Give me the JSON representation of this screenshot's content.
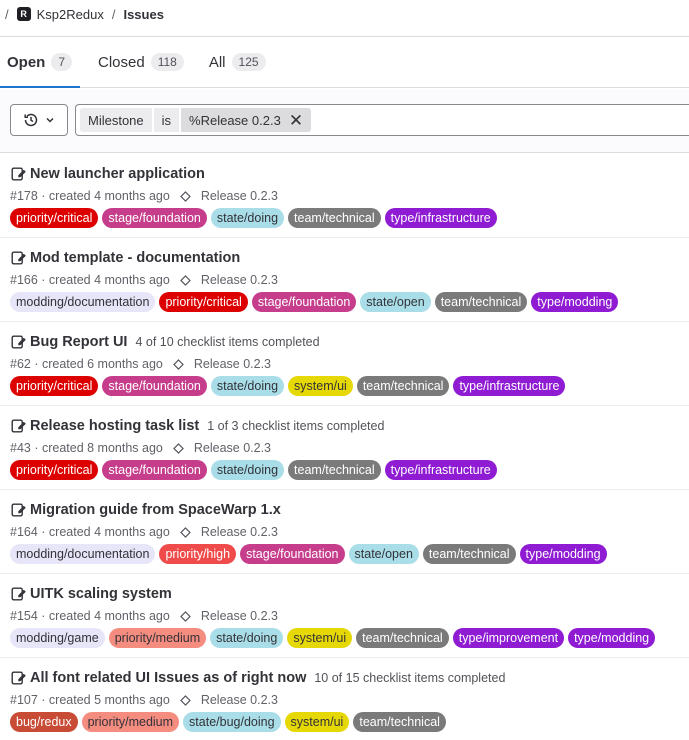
{
  "breadcrumb": {
    "separator": "/",
    "project_initial": "R",
    "project": "Ksp2Redux",
    "current": "Issues"
  },
  "tabs": [
    {
      "label": "Open",
      "count": "7",
      "active": true
    },
    {
      "label": "Closed",
      "count": "118",
      "active": false
    },
    {
      "label": "All",
      "count": "125",
      "active": false
    }
  ],
  "filter": {
    "history_icon": "history-icon",
    "token_name": "Milestone",
    "token_operator": "is",
    "token_value": "%Release 0.2.3",
    "close_glyph": "✕"
  },
  "label_colors": {
    "priority/critical": {
      "bg": "#dd0000",
      "fg": "#ffffff"
    },
    "priority/high": {
      "bg": "#ef4b4b",
      "fg": "#ffffff"
    },
    "priority/medium": {
      "bg": "#f48c80",
      "fg": "#333238"
    },
    "stage/foundation": {
      "bg": "#c53d8b",
      "fg": "#ffffff"
    },
    "state/doing": {
      "bg": "#a9dee9",
      "fg": "#333238"
    },
    "state/open": {
      "bg": "#a9dee9",
      "fg": "#333238"
    },
    "state/bug/doing": {
      "bg": "#a9dee9",
      "fg": "#333238"
    },
    "team/technical": {
      "bg": "#7a7a7a",
      "fg": "#ffffff"
    },
    "type/infrastructure": {
      "bg": "#8f1bd3",
      "fg": "#ffffff"
    },
    "type/modding": {
      "bg": "#8f1bd3",
      "fg": "#ffffff"
    },
    "type/improvement": {
      "bg": "#8f1bd3",
      "fg": "#ffffff"
    },
    "modding/documentation": {
      "bg": "#e7e5f8",
      "fg": "#333238"
    },
    "modding/game": {
      "bg": "#e7e5f8",
      "fg": "#333238"
    },
    "system/ui": {
      "bg": "#e6d805",
      "fg": "#333238"
    },
    "bug/redux": {
      "bg": "#c84b36",
      "fg": "#ffffff"
    }
  },
  "issues": [
    {
      "title": "New launcher application",
      "tasks": "",
      "meta": "#178 · created 4 months ago",
      "milestone": "Release 0.2.3",
      "labels": [
        "priority/critical",
        "stage/foundation",
        "state/doing",
        "team/technical",
        "type/infrastructure"
      ]
    },
    {
      "title": "Mod template - documentation",
      "tasks": "",
      "meta": "#166 · created 4 months ago",
      "milestone": "Release 0.2.3",
      "labels": [
        "modding/documentation",
        "priority/critical",
        "stage/foundation",
        "state/open",
        "team/technical",
        "type/modding"
      ]
    },
    {
      "title": "Bug Report UI",
      "tasks": "4 of 10 checklist items completed",
      "meta": "#62 · created 6 months ago",
      "milestone": "Release 0.2.3",
      "labels": [
        "priority/critical",
        "stage/foundation",
        "state/doing",
        "system/ui",
        "team/technical",
        "type/infrastructure"
      ]
    },
    {
      "title": "Release hosting task list",
      "tasks": "1 of 3 checklist items completed",
      "meta": "#43 · created 8 months ago",
      "milestone": "Release 0.2.3",
      "labels": [
        "priority/critical",
        "stage/foundation",
        "state/doing",
        "team/technical",
        "type/infrastructure"
      ]
    },
    {
      "title": "Migration guide from SpaceWarp 1.x",
      "tasks": "",
      "meta": "#164 · created 4 months ago",
      "milestone": "Release 0.2.3",
      "labels": [
        "modding/documentation",
        "priority/high",
        "stage/foundation",
        "state/open",
        "team/technical",
        "type/modding"
      ]
    },
    {
      "title": "UITK scaling system",
      "tasks": "",
      "meta": "#154 · created 4 months ago",
      "milestone": "Release 0.2.3",
      "labels": [
        "modding/game",
        "priority/medium",
        "state/doing",
        "system/ui",
        "team/technical",
        "type/improvement",
        "type/modding"
      ]
    },
    {
      "title": "All font related UI Issues as of right now",
      "tasks": "10 of 15 checklist items completed",
      "meta": "#107 · created 5 months ago",
      "milestone": "Release 0.2.3",
      "labels": [
        "bug/redux",
        "priority/medium",
        "state/bug/doing",
        "system/ui",
        "team/technical"
      ]
    }
  ]
}
